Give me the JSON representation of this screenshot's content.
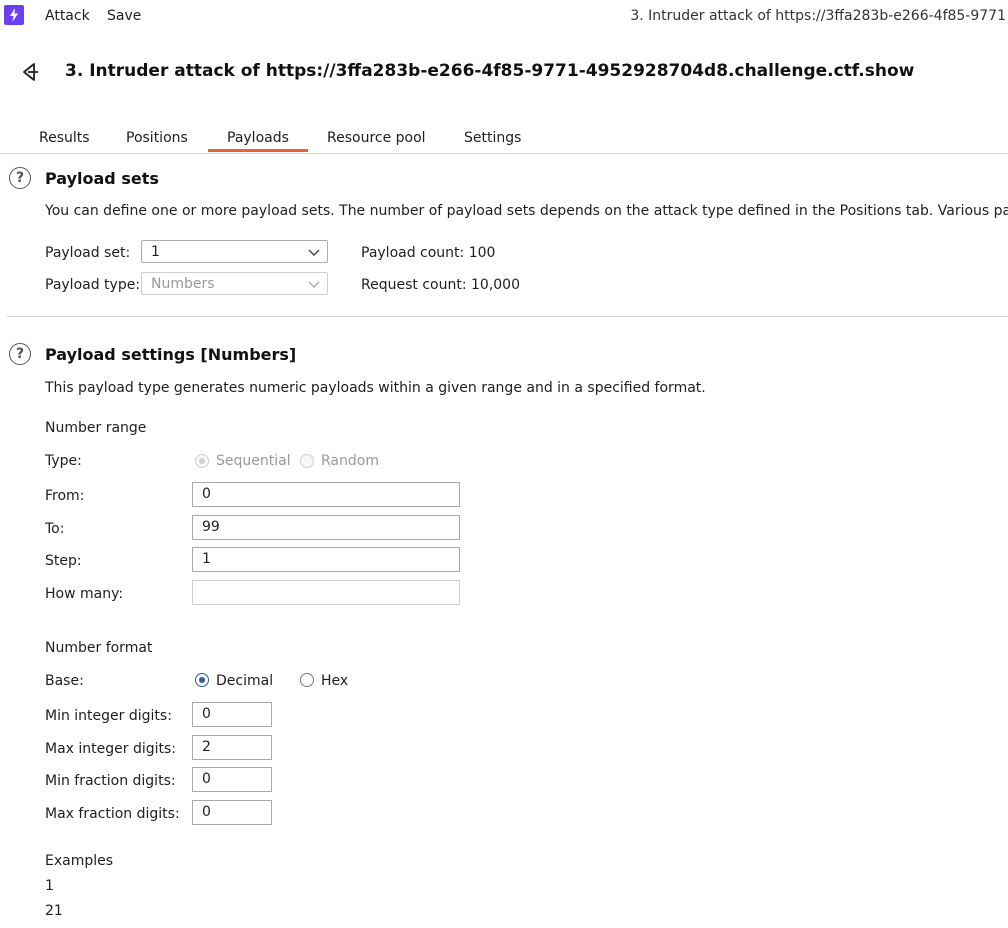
{
  "menubar": {
    "attack_label": "Attack",
    "save_label": "Save",
    "window_title": "3. Intruder attack of https://3ffa283b-e266-4f85-9771"
  },
  "header": {
    "title": "3. Intruder attack of https://3ffa283b-e266-4f85-9771-4952928704d8.challenge.ctf.show"
  },
  "tabs": [
    {
      "label": "Results"
    },
    {
      "label": "Positions"
    },
    {
      "label": "Payloads"
    },
    {
      "label": "Resource pool"
    },
    {
      "label": "Settings"
    }
  ],
  "active_tab": "Payloads",
  "payload_sets": {
    "title": "Payload sets",
    "description": "You can define one or more payload sets. The number of payload sets depends on the attack type defined in the Positions tab. Various payload",
    "set_label": "Payload set:",
    "set_value": "1",
    "type_label": "Payload type:",
    "type_value": "Numbers",
    "count_label": "Payload count:",
    "count_value": "100",
    "request_label": "Request count:",
    "request_value": "10,000"
  },
  "payload_settings": {
    "title": "Payload settings [Numbers]",
    "description": "This payload type generates numeric payloads within a given range and in a specified format.",
    "number_range": {
      "heading": "Number range",
      "type_label": "Type:",
      "sequential_label": "Sequential",
      "random_label": "Random",
      "from_label": "From:",
      "from_value": "0",
      "to_label": "To:",
      "to_value": "99",
      "step_label": "Step:",
      "step_value": "1",
      "how_many_label": "How many:",
      "how_many_value": ""
    },
    "number_format": {
      "heading": "Number format",
      "base_label": "Base:",
      "decimal_label": "Decimal",
      "hex_label": "Hex",
      "selected_base": "Decimal",
      "min_int_label": "Min integer digits:",
      "min_int_value": "0",
      "max_int_label": "Max integer digits:",
      "max_int_value": "2",
      "min_frac_label": "Min fraction digits:",
      "min_frac_value": "0",
      "max_frac_label": "Max fraction digits:",
      "max_frac_value": "0"
    },
    "examples": {
      "heading": "Examples",
      "items": [
        "1",
        "21"
      ]
    }
  },
  "colors": {
    "accent_tab": "#e8642e",
    "app_icon": "#6b3ff2",
    "radio_selected": "#2c5aa8"
  }
}
